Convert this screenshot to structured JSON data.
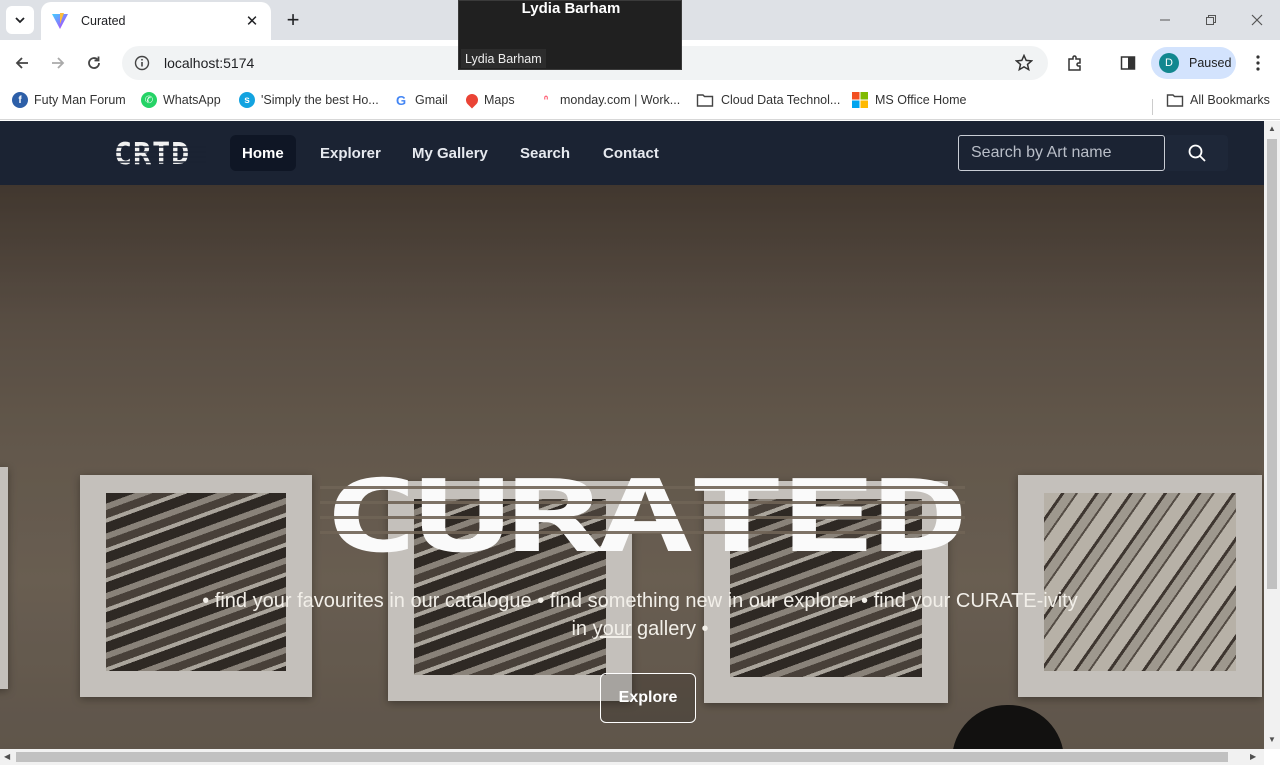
{
  "browser": {
    "tab_title": "Curated",
    "url": "localhost:5174",
    "profile_initial": "D",
    "profile_status": "Paused",
    "bookmarks": [
      {
        "label": "Futy Man Forum",
        "icon": "futy-icon",
        "color": "#2d5fa8"
      },
      {
        "label": "WhatsApp",
        "icon": "whatsapp-icon",
        "color": "#25d366"
      },
      {
        "label": "'Simply the best Ho...",
        "icon": "site-icon",
        "color": "#13a3e0"
      },
      {
        "label": "Gmail",
        "icon": "google-icon",
        "color": "#4285f4"
      },
      {
        "label": "Maps",
        "icon": "maps-icon",
        "color": "#ea4335"
      },
      {
        "label": "monday.com | Work...",
        "icon": "monday-icon",
        "color": "#ff3d57"
      },
      {
        "label": "Cloud Data Technol...",
        "icon": "folder-icon",
        "color": "#555"
      },
      {
        "label": "MS Office Home",
        "icon": "ms-office-icon",
        "color": "#f25022"
      }
    ],
    "all_bookmarks": "All Bookmarks"
  },
  "tooltip": {
    "name": "Lydia Barham",
    "subtitle": "Lydia Barham"
  },
  "site": {
    "logo": "CRTD",
    "nav": [
      "Home",
      "Explorer",
      "My Gallery",
      "Search",
      "Contact"
    ],
    "search_placeholder": "Search by Art name",
    "hero_title": "CURATED",
    "tagline_part1": "• find your favourites in our catalogue • find something new in our explorer • find your CURATE-ivity in ",
    "tagline_underlined": "your",
    "tagline_part2": " gallery •",
    "explore_label": "Explore"
  },
  "colors": {
    "nav_bg": "#1b2333",
    "nav_active_bg": "#0f1625",
    "text_light": "#f2efe9"
  }
}
